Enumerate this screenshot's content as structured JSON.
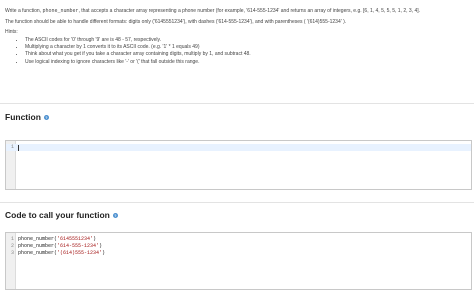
{
  "problem": {
    "intro_part1": "Write a function, ",
    "function_name": "phone_number",
    "intro_part2": ", that accepts a character array representing a phone number (for example, '614-555-1234' and returns an array of integers, e.g. [6, 1, 4, 5, 5, 5, 1, 2, 3, 4].",
    "formats": "The function should be able to handle different formats: digits only ('6145551234'), with dashes ('614-555-1234'), and with parentheses ( '(614)555-1234' ).",
    "hints_label": "Hints:",
    "hints": [
      "The ASCII codes for '0' through '9' are is 48 - 57, respectively.",
      "Multiplying a character by 1 converts it to its ASCII code. (e.g. '1' * 1 equals 49)",
      "Think about what you get if you take a character array containing digits, multiply by 1, and subtract 48.",
      "Use logical indexing to ignore characters like '-' or '(' that fall outside this range."
    ]
  },
  "function_section": {
    "title": "Function",
    "editor": {
      "line_numbers": [
        "1"
      ],
      "lines": [
        ""
      ]
    }
  },
  "call_section": {
    "title": "Code to call your function",
    "editor": {
      "line_numbers": [
        "1",
        "2",
        "3"
      ],
      "lines": [
        {
          "fn": "phone_number(",
          "arg": "'6145551234'",
          "end": ")"
        },
        {
          "fn": "phone_number(",
          "arg": "'614-555-1234'",
          "end": ")"
        },
        {
          "fn": "phone_number(",
          "arg": "'(614)555-1234'",
          "end": ")"
        }
      ]
    }
  },
  "colors": {
    "help_icon": "#4a8fcf",
    "string_literal": "#a31515",
    "active_line": "#e8f2ff"
  },
  "icons": {
    "help": "question-circle-icon"
  }
}
